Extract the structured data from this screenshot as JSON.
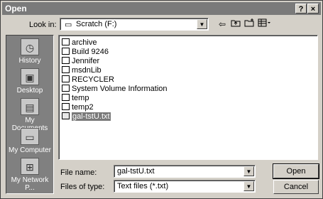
{
  "window": {
    "title": "Open",
    "help_label": "?",
    "close_label": "×"
  },
  "look_in": {
    "label": "Look in:",
    "value": "Scratch (F:)"
  },
  "toolbar": {
    "back_icon": "⇦",
    "up_icon": "up-folder",
    "newfolder_icon": "new-folder",
    "views_icon": "views-menu"
  },
  "places": [
    {
      "label": "History",
      "icon": "history-icon"
    },
    {
      "label": "Desktop",
      "icon": "desktop-icon"
    },
    {
      "label": "My Documents",
      "icon": "my-documents-icon"
    },
    {
      "label": "My Computer",
      "icon": "my-computer-icon"
    },
    {
      "label": "My Network P...",
      "icon": "my-network-icon"
    }
  ],
  "files": [
    {
      "name": "archive",
      "type": "folder"
    },
    {
      "name": "Build 9246",
      "type": "folder"
    },
    {
      "name": "Jennifer",
      "type": "folder"
    },
    {
      "name": "msdnLib",
      "type": "folder"
    },
    {
      "name": "RECYCLER",
      "type": "folder"
    },
    {
      "name": "System Volume Information",
      "type": "folder"
    },
    {
      "name": "temp",
      "type": "folder"
    },
    {
      "name": "temp2",
      "type": "folder"
    },
    {
      "name": "gal-tstU.txt",
      "type": "file",
      "selected": true
    }
  ],
  "file_name": {
    "label": "File name:",
    "value": "gal-tstU.txt"
  },
  "file_type": {
    "label": "Files of type:",
    "value": "Text files (*.txt)"
  },
  "buttons": {
    "open": "Open",
    "cancel": "Cancel"
  }
}
